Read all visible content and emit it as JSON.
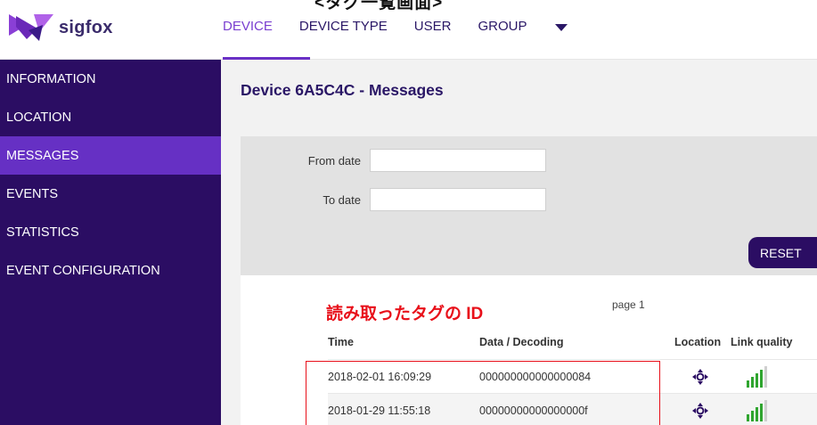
{
  "annotations": {
    "top": "<タグ一覧画面>",
    "tag_id": "読み取ったタグの ID"
  },
  "header": {
    "logo_text": "sigfox",
    "nav": [
      {
        "label": "DEVICE",
        "active": true
      },
      {
        "label": "DEVICE TYPE",
        "active": false
      },
      {
        "label": "USER",
        "active": false
      },
      {
        "label": "GROUP",
        "active": false
      }
    ],
    "more_icon": "chevron-down-icon"
  },
  "sidebar": {
    "items": [
      {
        "label": "INFORMATION",
        "active": false
      },
      {
        "label": "LOCATION",
        "active": false
      },
      {
        "label": "MESSAGES",
        "active": true
      },
      {
        "label": "EVENTS",
        "active": false
      },
      {
        "label": "STATISTICS",
        "active": false
      },
      {
        "label": "EVENT CONFIGURATION",
        "active": false
      }
    ]
  },
  "main": {
    "title": "Device 6A5C4C - Messages",
    "filter": {
      "from_label": "From date",
      "from_value": "",
      "to_label": "To date",
      "to_value": "",
      "reset_label": "RESET"
    },
    "page_label": "page 1",
    "table": {
      "headers": [
        "Time",
        "Data / Decoding",
        "Location",
        "Link quality"
      ],
      "rows": [
        {
          "time": "2018-02-01 16:09:29",
          "data": "000000000000000084",
          "location_icon": "crosshair-icon",
          "link_quality": 4
        },
        {
          "time": "2018-01-29 11:55:18",
          "data": "00000000000000000f",
          "location_icon": "crosshair-icon",
          "link_quality": 4
        }
      ]
    }
  },
  "colors": {
    "brand_dark": "#2b0d63",
    "brand_active": "#6630c4",
    "annotation_red": "#e8101a",
    "signal_green": "#2fa52f"
  }
}
